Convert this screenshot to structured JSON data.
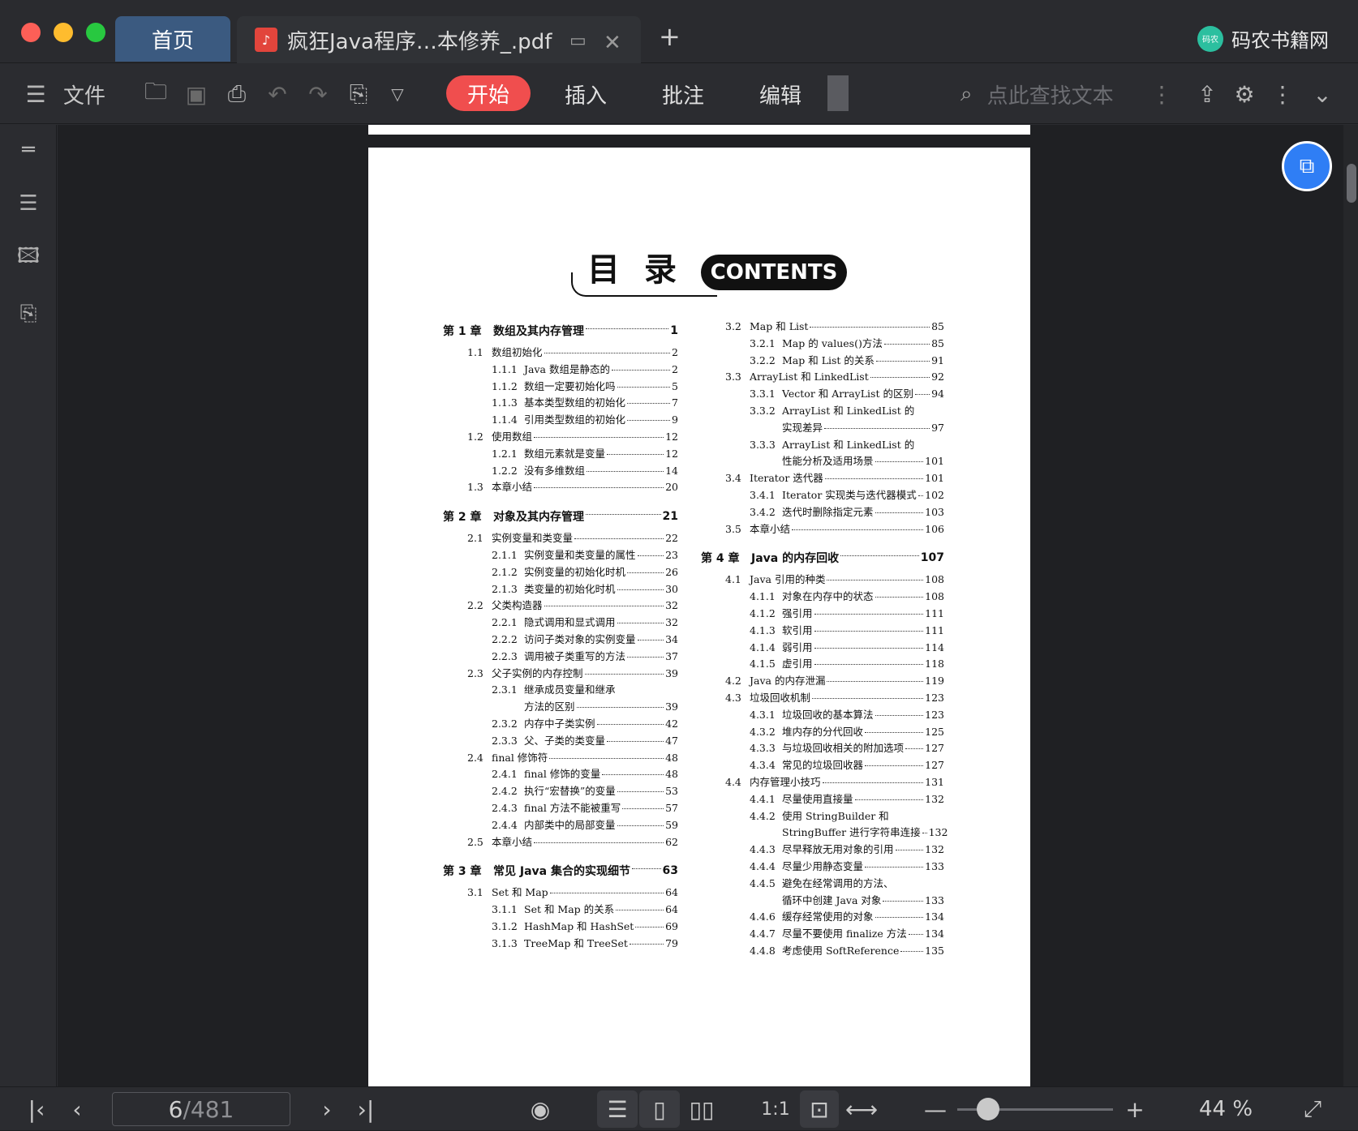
{
  "tabs": {
    "home": "首页",
    "doc_title": "疯狂Java程序…本修养_.pdf",
    "pdf_badge": "PDF"
  },
  "brand": {
    "name": "码农书籍网",
    "logo_text": "码农"
  },
  "toolbar": {
    "file_label": "文件",
    "start_label": "开始",
    "insert_label": "插入",
    "annotate_label": "批注",
    "edit_label": "编辑",
    "search_placeholder": "点此查找文本"
  },
  "colors": {
    "accent": "#f04e4e",
    "home_tab": "#3b5a80",
    "float_button": "#2f7ef5"
  },
  "page_nav": {
    "current": "6",
    "total": "/481"
  },
  "zoom": {
    "level": "44 %",
    "slider_fraction": 0.2
  },
  "toc": {
    "title_cn": "目录",
    "title_en": "CONTENTS",
    "left": [
      {
        "lv": 0,
        "num": "第 1 章",
        "text": "数组及其内存管理",
        "pg": "1"
      },
      {
        "lv": 1,
        "num": "1.1",
        "text": "数组初始化",
        "pg": "2"
      },
      {
        "lv": 2,
        "num": "1.1.1",
        "text": "Java 数组是静态的",
        "pg": "2"
      },
      {
        "lv": 2,
        "num": "1.1.2",
        "text": "数组一定要初始化吗",
        "pg": "5"
      },
      {
        "lv": 2,
        "num": "1.1.3",
        "text": "基本类型数组的初始化",
        "pg": "7"
      },
      {
        "lv": 2,
        "num": "1.1.4",
        "text": "引用类型数组的初始化",
        "pg": "9"
      },
      {
        "lv": 1,
        "num": "1.2",
        "text": "使用数组",
        "pg": "12"
      },
      {
        "lv": 2,
        "num": "1.2.1",
        "text": "数组元素就是变量",
        "pg": "12"
      },
      {
        "lv": 2,
        "num": "1.2.2",
        "text": "没有多维数组",
        "pg": "14"
      },
      {
        "lv": 1,
        "num": "1.3",
        "text": "本章小结",
        "pg": "20"
      },
      {
        "lv": 0,
        "num": "第 2 章",
        "text": "对象及其内存管理",
        "pg": "21"
      },
      {
        "lv": 1,
        "num": "2.1",
        "text": "实例变量和类变量",
        "pg": "22"
      },
      {
        "lv": 2,
        "num": "2.1.1",
        "text": "实例变量和类变量的属性",
        "pg": "23"
      },
      {
        "lv": 2,
        "num": "2.1.2",
        "text": "实例变量的初始化时机",
        "pg": "26"
      },
      {
        "lv": 2,
        "num": "2.1.3",
        "text": "类变量的初始化时机",
        "pg": "30"
      },
      {
        "lv": 1,
        "num": "2.2",
        "text": "父类构造器",
        "pg": "32"
      },
      {
        "lv": 2,
        "num": "2.2.1",
        "text": "隐式调用和显式调用",
        "pg": "32"
      },
      {
        "lv": 2,
        "num": "2.2.2",
        "text": "访问子类对象的实例变量",
        "pg": "34"
      },
      {
        "lv": 2,
        "num": "2.2.3",
        "text": "调用被子类重写的方法",
        "pg": "37"
      },
      {
        "lv": 1,
        "num": "2.3",
        "text": "父子实例的内存控制",
        "pg": "39"
      },
      {
        "lv": 2,
        "num": "2.3.1",
        "text": "继承成员变量和继承",
        "pg": ""
      },
      {
        "lv": 3,
        "num": "",
        "text": "方法的区别",
        "pg": "39"
      },
      {
        "lv": 2,
        "num": "2.3.2",
        "text": "内存中子类实例",
        "pg": "42"
      },
      {
        "lv": 2,
        "num": "2.3.3",
        "text": "父、子类的类变量",
        "pg": "47"
      },
      {
        "lv": 1,
        "num": "2.4",
        "text": "final 修饰符",
        "pg": "48"
      },
      {
        "lv": 2,
        "num": "2.4.1",
        "text": "final 修饰的变量",
        "pg": "48"
      },
      {
        "lv": 2,
        "num": "2.4.2",
        "text": "执行“宏替换”的变量",
        "pg": "53"
      },
      {
        "lv": 2,
        "num": "2.4.3",
        "text": "final 方法不能被重写",
        "pg": "57"
      },
      {
        "lv": 2,
        "num": "2.4.4",
        "text": "内部类中的局部变量",
        "pg": "59"
      },
      {
        "lv": 1,
        "num": "2.5",
        "text": "本章小结",
        "pg": "62"
      },
      {
        "lv": 0,
        "num": "第 3 章",
        "text": "常见 Java 集合的实现细节",
        "pg": "63"
      },
      {
        "lv": 1,
        "num": "3.1",
        "text": "Set 和 Map",
        "pg": "64"
      },
      {
        "lv": 2,
        "num": "3.1.1",
        "text": "Set 和 Map 的关系",
        "pg": "64"
      },
      {
        "lv": 2,
        "num": "3.1.2",
        "text": "HashMap 和 HashSet",
        "pg": "69"
      },
      {
        "lv": 2,
        "num": "3.1.3",
        "text": "TreeMap 和 TreeSet",
        "pg": "79"
      }
    ],
    "right": [
      {
        "lv": 1,
        "num": "3.2",
        "text": "Map 和 List",
        "pg": "85"
      },
      {
        "lv": 2,
        "num": "3.2.1",
        "text": "Map 的 values()方法",
        "pg": "85"
      },
      {
        "lv": 2,
        "num": "3.2.2",
        "text": "Map 和 List 的关系",
        "pg": "91"
      },
      {
        "lv": 1,
        "num": "3.3",
        "text": "ArrayList 和 LinkedList",
        "pg": "92"
      },
      {
        "lv": 2,
        "num": "3.3.1",
        "text": "Vector 和 ArrayList 的区别",
        "pg": "94"
      },
      {
        "lv": 2,
        "num": "3.3.2",
        "text": "ArrayList 和 LinkedList 的",
        "pg": ""
      },
      {
        "lv": 3,
        "num": "",
        "text": "实现差异",
        "pg": "97"
      },
      {
        "lv": 2,
        "num": "3.3.3",
        "text": "ArrayList 和 LinkedList 的",
        "pg": ""
      },
      {
        "lv": 3,
        "num": "",
        "text": "性能分析及适用场景",
        "pg": "101"
      },
      {
        "lv": 1,
        "num": "3.4",
        "text": "Iterator 迭代器",
        "pg": "101"
      },
      {
        "lv": 2,
        "num": "3.4.1",
        "text": "Iterator 实现类与迭代器模式",
        "pg": "102"
      },
      {
        "lv": 2,
        "num": "3.4.2",
        "text": "迭代时删除指定元素",
        "pg": "103"
      },
      {
        "lv": 1,
        "num": "3.5",
        "text": "本章小结",
        "pg": "106"
      },
      {
        "lv": 0,
        "num": "第 4 章",
        "text": "Java 的内存回收",
        "pg": "107"
      },
      {
        "lv": 1,
        "num": "4.1",
        "text": "Java 引用的种类",
        "pg": "108"
      },
      {
        "lv": 2,
        "num": "4.1.1",
        "text": "对象在内存中的状态",
        "pg": "108"
      },
      {
        "lv": 2,
        "num": "4.1.2",
        "text": "强引用",
        "pg": "111"
      },
      {
        "lv": 2,
        "num": "4.1.3",
        "text": "软引用",
        "pg": "111"
      },
      {
        "lv": 2,
        "num": "4.1.4",
        "text": "弱引用",
        "pg": "114"
      },
      {
        "lv": 2,
        "num": "4.1.5",
        "text": "虚引用",
        "pg": "118"
      },
      {
        "lv": 1,
        "num": "4.2",
        "text": "Java 的内存泄漏",
        "pg": "119"
      },
      {
        "lv": 1,
        "num": "4.3",
        "text": "垃圾回收机制",
        "pg": "123"
      },
      {
        "lv": 2,
        "num": "4.3.1",
        "text": "垃圾回收的基本算法",
        "pg": "123"
      },
      {
        "lv": 2,
        "num": "4.3.2",
        "text": "堆内存的分代回收",
        "pg": "125"
      },
      {
        "lv": 2,
        "num": "4.3.3",
        "text": "与垃圾回收相关的附加选项",
        "pg": "127"
      },
      {
        "lv": 2,
        "num": "4.3.4",
        "text": "常见的垃圾回收器",
        "pg": "127"
      },
      {
        "lv": 1,
        "num": "4.4",
        "text": "内存管理小技巧",
        "pg": "131"
      },
      {
        "lv": 2,
        "num": "4.4.1",
        "text": "尽量使用直接量",
        "pg": "132"
      },
      {
        "lv": 2,
        "num": "4.4.2",
        "text": "使用 StringBuilder 和",
        "pg": ""
      },
      {
        "lv": 3,
        "num": "",
        "text": "StringBuffer 进行字符串连接",
        "pg": "132"
      },
      {
        "lv": 2,
        "num": "4.4.3",
        "text": "尽早释放无用对象的引用",
        "pg": "132"
      },
      {
        "lv": 2,
        "num": "4.4.4",
        "text": "尽量少用静态变量",
        "pg": "133"
      },
      {
        "lv": 2,
        "num": "4.4.5",
        "text": "避免在经常调用的方法、",
        "pg": ""
      },
      {
        "lv": 3,
        "num": "",
        "text": "循环中创建 Java 对象",
        "pg": "133"
      },
      {
        "lv": 2,
        "num": "4.4.6",
        "text": "缓存经常使用的对象",
        "pg": "134"
      },
      {
        "lv": 2,
        "num": "4.4.7",
        "text": "尽量不要使用 finalize 方法",
        "pg": "134"
      },
      {
        "lv": 2,
        "num": "4.4.8",
        "text": "考虑使用 SoftReference",
        "pg": "135"
      }
    ]
  }
}
